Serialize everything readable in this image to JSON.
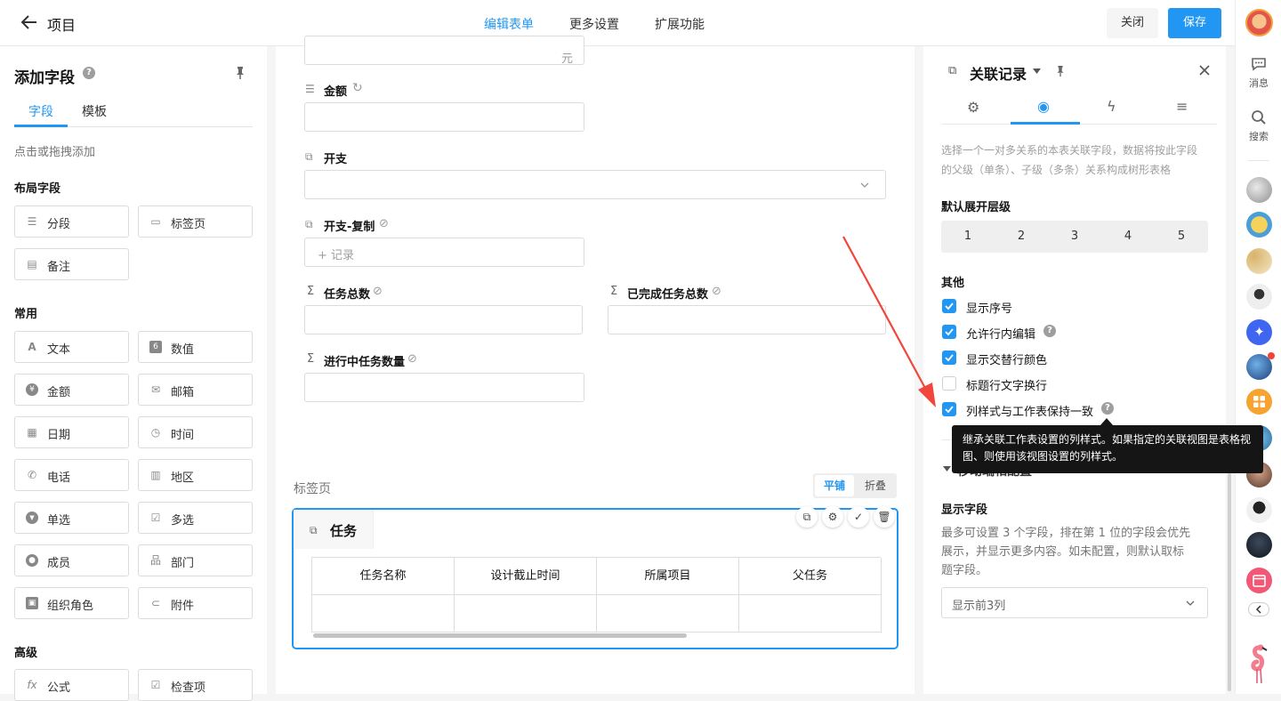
{
  "header": {
    "back_label": "项目",
    "tabs": [
      "编辑表单",
      "更多设置",
      "扩展功能"
    ],
    "close_label": "关闭",
    "save_label": "保存"
  },
  "rail": {
    "messages_label": "消息",
    "search_label": "搜索"
  },
  "left": {
    "title": "添加字段",
    "tabs": [
      "字段",
      "模板"
    ],
    "hint": "点击或拖拽添加",
    "sections": {
      "layout": "布局字段",
      "common": "常用",
      "advanced": "高级"
    },
    "layout_fields": [
      "分段",
      "标签页",
      "备注"
    ],
    "common_fields": [
      "文本",
      "数值",
      "金额",
      "邮箱",
      "日期",
      "时间",
      "电话",
      "地区",
      "单选",
      "多选",
      "成员",
      "部门",
      "组织角色",
      "附件"
    ],
    "advanced_fields": [
      "公式",
      "检查项"
    ]
  },
  "form": {
    "unit_yuan": "元",
    "amount_label": "金额",
    "expense_label": "开支",
    "expense_copy_label": "开支-复制",
    "record_placeholder": "+ 记录",
    "task_total_label": "任务总数",
    "completed_total_label": "已完成任务总数",
    "in_progress_label": "进行中任务数量",
    "tabs_section_label": "标签页",
    "tile_label": "平铺",
    "fold_label": "折叠",
    "tab_card_title": "任务",
    "table_headers": [
      "任务名称",
      "设计截止时间",
      "所属项目",
      "父任务"
    ]
  },
  "panel": {
    "title": "关联记录",
    "description": "选择一个一对多关系的本表关联字段，数据将按此字段的父级（单条）、子级（多条）关系构成树形表格",
    "expand_level_label": "默认展开层级",
    "levels": [
      "1",
      "2",
      "3",
      "4",
      "5"
    ],
    "other_label": "其他",
    "options": [
      {
        "label": "显示序号",
        "checked": true
      },
      {
        "label": "允许行内编辑",
        "checked": true
      },
      {
        "label": "显示交替行颜色",
        "checked": true
      },
      {
        "label": "标题行文字换行",
        "checked": false
      },
      {
        "label": "列样式与工作表保持一致",
        "checked": true
      }
    ],
    "hidden_section_partial": "移动端相配置",
    "tooltip": "继承关联工作表设置的列样式。如果指定的关联视图是表格视图、则使用该视图设置的列样式。",
    "display_fields_label": "显示字段",
    "display_fields_desc": "最多可设置 3 个字段，排在第 1 位的字段会优先展示，并显示更多内容。如未配置，则默认取标题字段。",
    "display_select_value": "显示前3列"
  },
  "colors": {
    "accent": "#2196f3",
    "annotation_arrow": "#f0463c",
    "tooltip_bg": "#151515"
  }
}
